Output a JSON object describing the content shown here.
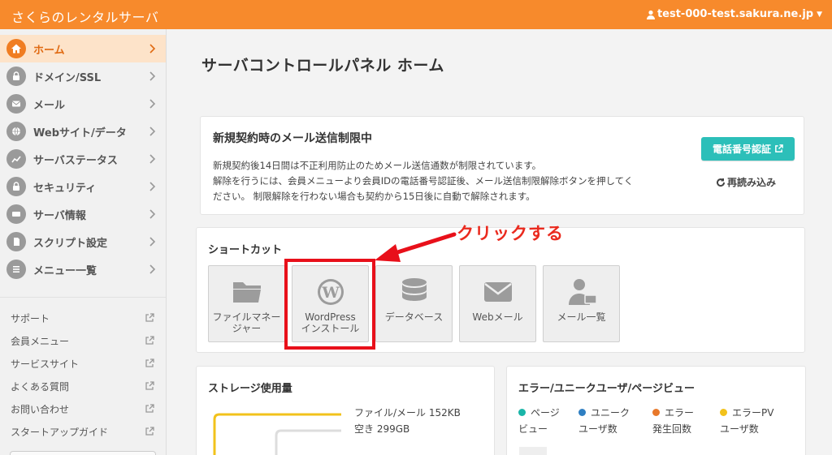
{
  "app": {
    "brand": "さくらのレンタルサーバ",
    "user": "test-000-test.sakura.ne.jp",
    "accent_color": "#f78a2c"
  },
  "sidebar": {
    "items": [
      {
        "label": "ホーム",
        "icon": "home-icon",
        "active": true
      },
      {
        "label": "ドメイン/SSL",
        "icon": "lock-icon"
      },
      {
        "label": "メール",
        "icon": "mail-icon"
      },
      {
        "label": "Webサイト/データ",
        "icon": "globe-icon"
      },
      {
        "label": "サーバステータス",
        "icon": "chart-icon"
      },
      {
        "label": "セキュリティ",
        "icon": "security-lock-icon"
      },
      {
        "label": "サーバ情報",
        "icon": "server-icon"
      },
      {
        "label": "スクリプト設定",
        "icon": "script-icon"
      },
      {
        "label": "メニュー一覧",
        "icon": "list-icon"
      }
    ],
    "links": [
      {
        "label": "サポート"
      },
      {
        "label": "会員メニュー"
      },
      {
        "label": "サービスサイト"
      },
      {
        "label": "よくある質問"
      },
      {
        "label": "お問い合わせ"
      },
      {
        "label": "スタートアップガイド"
      }
    ]
  },
  "main": {
    "title": "サーバコントロールパネル ホーム",
    "notice": {
      "title": "新規契約時のメール送信制限中",
      "line1": "新規契約後14日間は不正利用防止のためメール送信通数が制限されています。",
      "line2": "解除を行うには、会員メニューより会員IDの電話番号認証後、メール送信制限解除ボタンを押してく",
      "line3": "ださい。 制限解除を行わない場合も契約から15日後に自動で解除されます。",
      "phone_button": "電話番号認証",
      "reload": "再読み込み"
    },
    "shortcut": {
      "title": "ショートカット",
      "tiles": [
        {
          "label": "ファイルマネー\nジャー",
          "icon": "folder-icon"
        },
        {
          "label": "WordPress\nインストール",
          "icon": "wordpress-icon"
        },
        {
          "label": "データベース",
          "icon": "database-icon"
        },
        {
          "label": "Webメール",
          "icon": "envelope-icon"
        },
        {
          "label": "メール一覧",
          "icon": "user-mail-icon"
        }
      ]
    },
    "annotation": "クリックする",
    "storage": {
      "title": "ストレージ使用量",
      "used": "ファイル/メール 152KB",
      "free": "空き 299GB"
    },
    "pageview": {
      "title": "エラー/ユニークユーザ/ページビュー",
      "legend": [
        {
          "line1": "ページ",
          "line2": "ビュー",
          "color": "#1ab5a8"
        },
        {
          "line1": "ユニーク",
          "line2": "ユーザ数",
          "color": "#2f7fc2"
        },
        {
          "line1": "エラー",
          "line2": "発生回数",
          "color": "#e8782a"
        },
        {
          "line1": "エラーPV",
          "line2": "ユーザ数",
          "color": "#f2c21b"
        }
      ]
    }
  }
}
